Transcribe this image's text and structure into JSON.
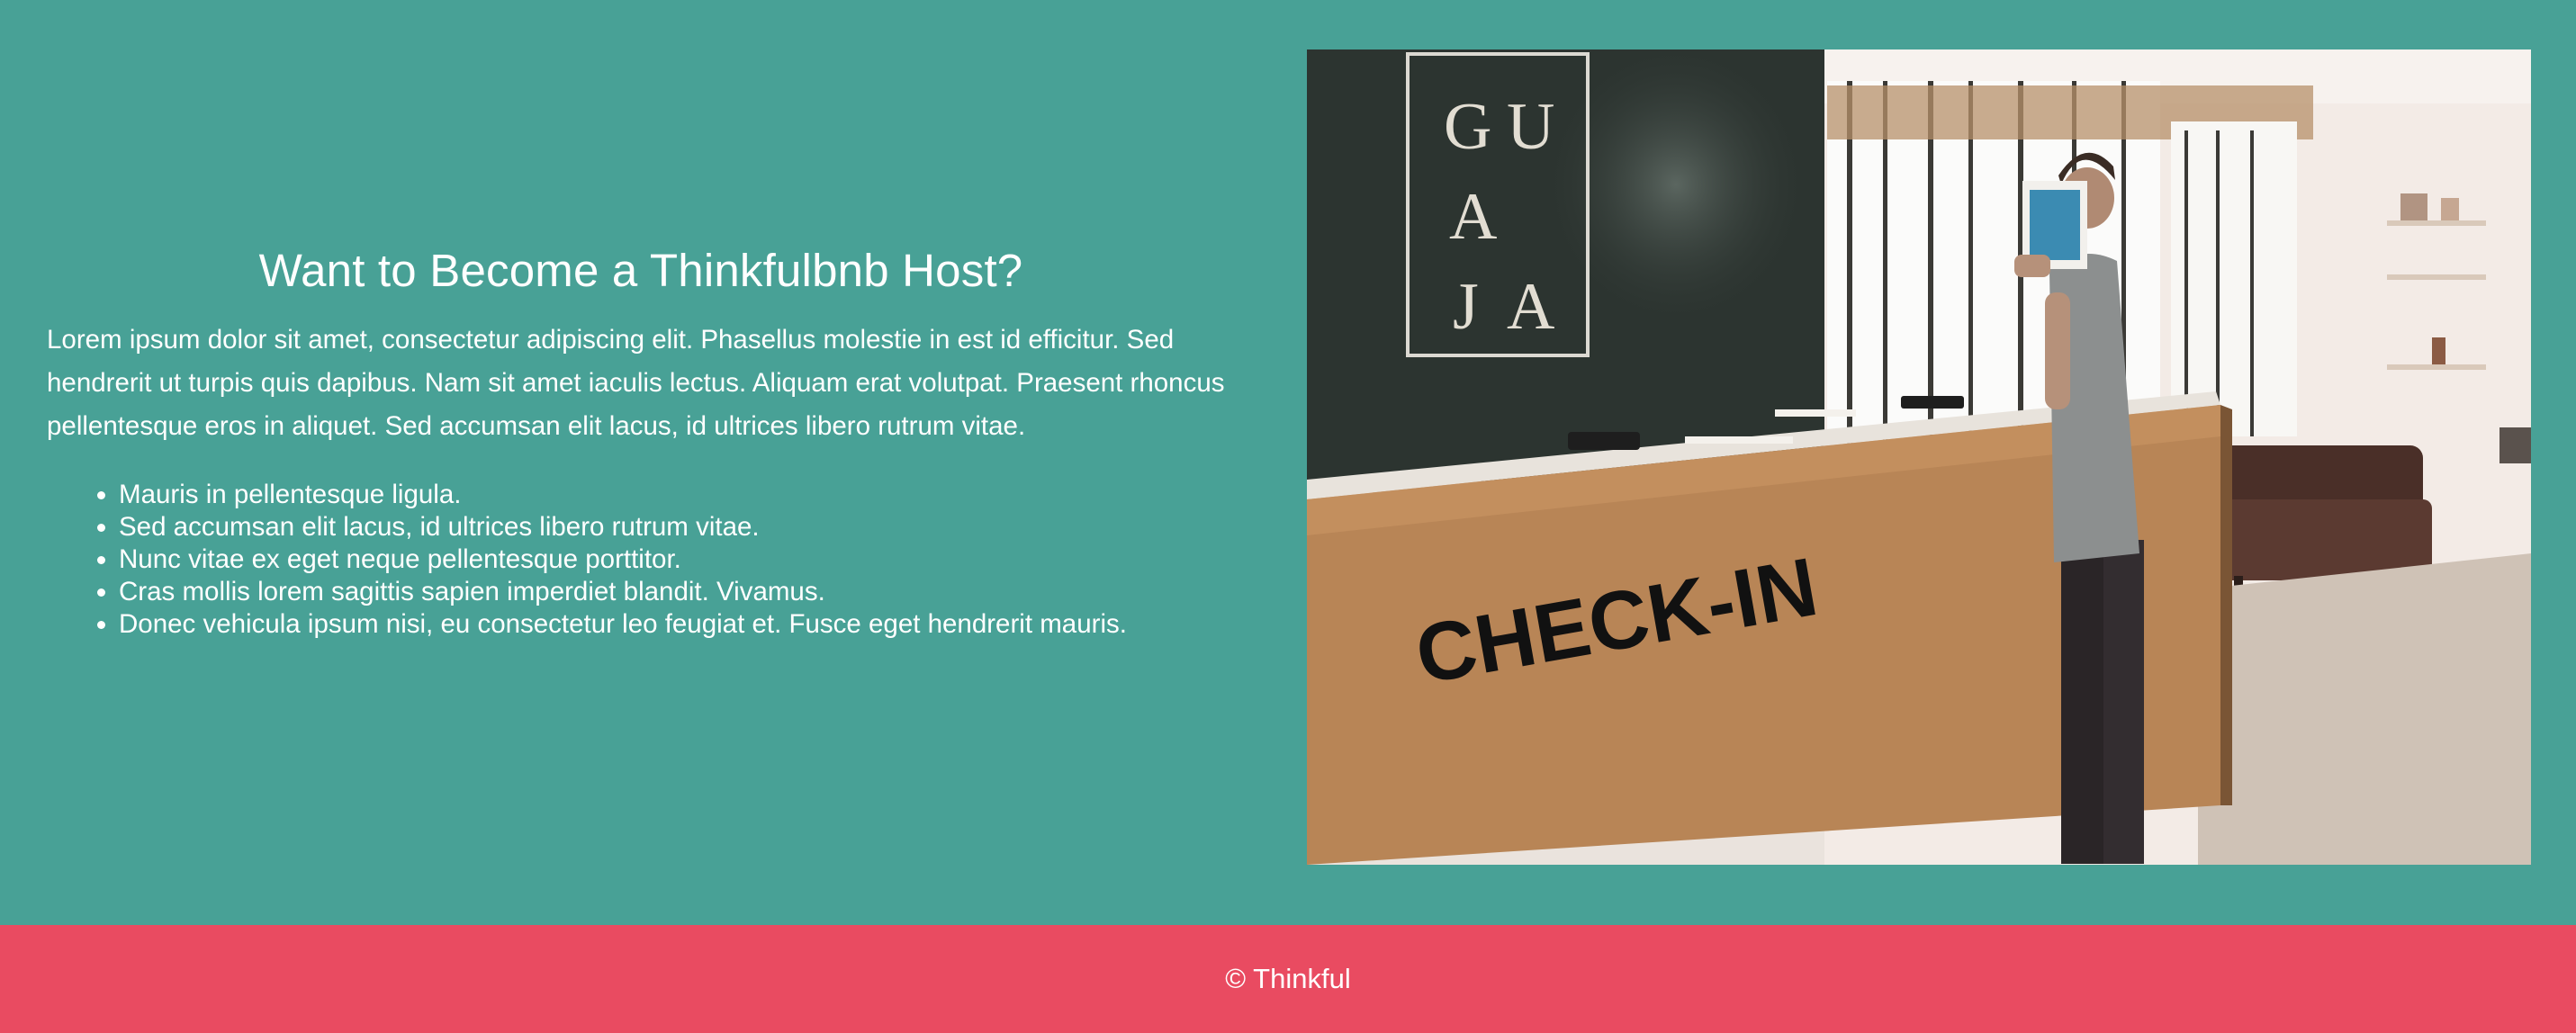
{
  "host_section": {
    "title": "Want to Become a Thinkfulbnb Host?",
    "paragraph": "Lorem ipsum dolor sit amet, consectetur adipiscing elit. Phasellus molestie in est id efficitur. Sed hendrerit ut turpis quis dapibus. Nam sit amet iaculis lectus. Aliquam erat volutpat. Praesent rhoncus pellentesque eros in aliquet. Sed accumsan elit lacus, id ultrices libero rutrum vitae.",
    "list_items": [
      "Mauris in pellentesque ligula.",
      "Sed accumsan elit lacus, id ultrices libero rutrum vitae.",
      "Nunc vitae ex eget neque pellentesque porttitor.",
      "Cras mollis lorem sagittis sapien imperdiet blandit. Vivamus.",
      "Donec vehicula ipsum nisi, eu consectetur leo feugiat et. Fusce eget hendrerit mauris."
    ],
    "photo": {
      "sign_letters": [
        "G",
        "U",
        "A",
        "J",
        "A"
      ],
      "desk_text": "CHECK-IN"
    }
  },
  "footer": {
    "text": "© Thinkful"
  },
  "colors": {
    "section_background": "#48a196",
    "footer_background": "#e94b61",
    "text": "#ffffff"
  }
}
